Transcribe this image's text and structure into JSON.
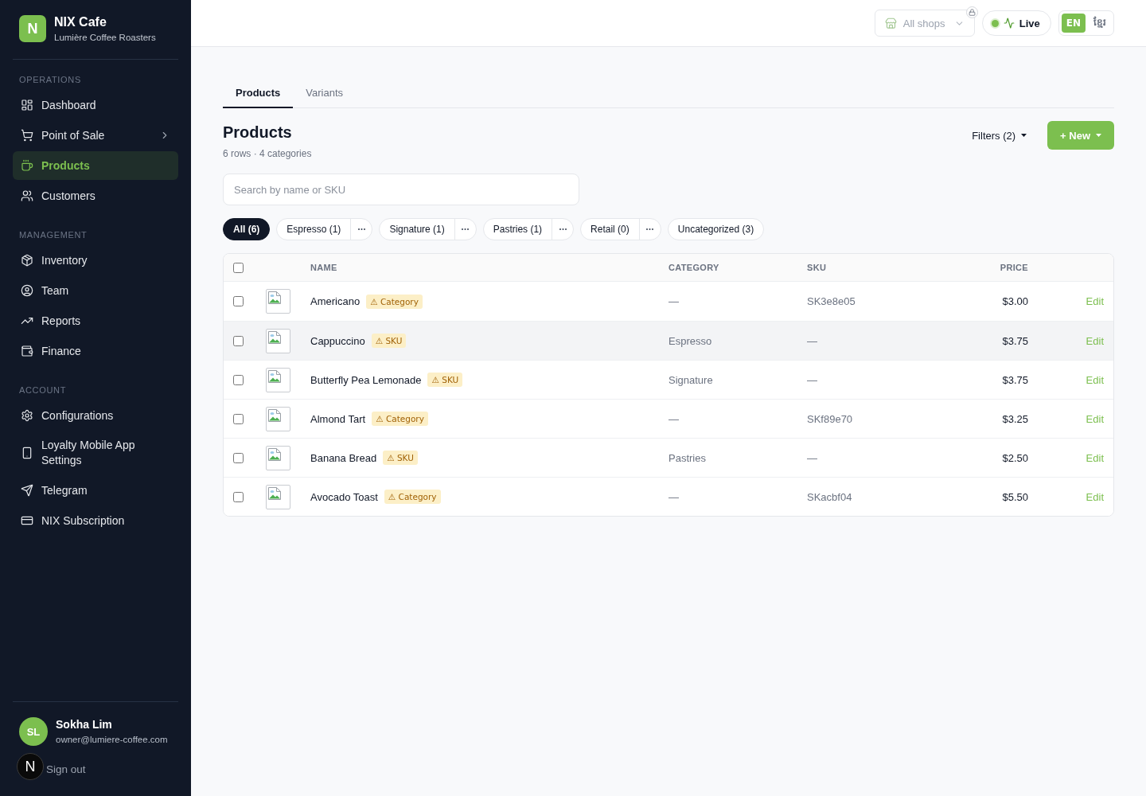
{
  "sidebar": {
    "brand": {
      "logo": "N",
      "name": "NIX Cafe",
      "subtitle": "Lumière Coffee Roasters"
    },
    "sections": [
      {
        "title": "OPERATIONS",
        "items": [
          {
            "label": "Dashboard",
            "selected": false,
            "has_submenu": false
          },
          {
            "label": "Point of Sale",
            "selected": false,
            "has_submenu": true
          },
          {
            "label": "Products",
            "selected": true,
            "has_submenu": false
          },
          {
            "label": "Customers",
            "selected": false,
            "has_submenu": false
          }
        ]
      },
      {
        "title": "MANAGEMENT",
        "items": [
          {
            "label": "Inventory",
            "selected": false,
            "has_submenu": false
          },
          {
            "label": "Team",
            "selected": false,
            "has_submenu": false
          },
          {
            "label": "Reports",
            "selected": false,
            "has_submenu": false
          },
          {
            "label": "Finance",
            "selected": false,
            "has_submenu": false
          }
        ]
      },
      {
        "title": "ACCOUNT",
        "items": [
          {
            "label": "Configurations",
            "selected": false,
            "has_submenu": false
          },
          {
            "label": "Loyalty Mobile App Settings",
            "selected": false,
            "has_submenu": false
          },
          {
            "label": "Telegram",
            "selected": false,
            "has_submenu": false
          },
          {
            "label": "NIX Subscription",
            "selected": false,
            "has_submenu": false
          }
        ]
      }
    ],
    "user": {
      "initials": "SL",
      "name": "Sokha Lim",
      "email": "owner@lumiere-coffee.com"
    },
    "sign_out": "Sign out"
  },
  "top_bar": {
    "shop_selector": {
      "label": "All shops",
      "locked": true
    },
    "live_status": {
      "label": "Live"
    },
    "languages": [
      {
        "label": "EN",
        "selected": true
      },
      {
        "label": "ខ្មែរ",
        "selected": false
      }
    ]
  },
  "tabs": [
    {
      "label": "Products",
      "selected": true
    },
    {
      "label": "Variants",
      "selected": false
    }
  ],
  "page_header": {
    "title": "Products",
    "subtitle": "6 rows · 4 categories",
    "filters_button": "Filters (2)",
    "new_button": "+ New"
  },
  "search": {
    "placeholder": "Search by name or SKU"
  },
  "category_chips": [
    {
      "label": "All (6)",
      "selected": true,
      "has_menu": false
    },
    {
      "label": "Espresso (1)",
      "selected": false,
      "has_menu": true
    },
    {
      "label": "Signature (1)",
      "selected": false,
      "has_menu": true
    },
    {
      "label": "Pastries (1)",
      "selected": false,
      "has_menu": true
    },
    {
      "label": "Retail (0)",
      "selected": false,
      "has_menu": true
    },
    {
      "label": "Uncategorized (3)",
      "selected": false,
      "has_menu": false
    }
  ],
  "table": {
    "all_checked": false,
    "columns": [
      "NAME",
      "CATEGORY",
      "SKU",
      "PRICE"
    ],
    "rows": [
      {
        "name": "Americano",
        "warning": "⚠ Category",
        "category": "—",
        "sku": "SK3e8e05",
        "price": "$3.00",
        "action": "Edit",
        "checked": false,
        "hovered": false
      },
      {
        "name": "Cappuccino",
        "warning": "⚠ SKU",
        "category": "Espresso",
        "sku": "—",
        "price": "$3.75",
        "action": "Edit",
        "checked": false,
        "hovered": true
      },
      {
        "name": "Butterfly Pea Lemonade",
        "warning": "⚠ SKU",
        "category": "Signature",
        "sku": "—",
        "price": "$3.75",
        "action": "Edit",
        "checked": false,
        "hovered": false
      },
      {
        "name": "Almond Tart",
        "warning": "⚠ Category",
        "category": "—",
        "sku": "SKf89e70",
        "price": "$3.25",
        "action": "Edit",
        "checked": false,
        "hovered": false
      },
      {
        "name": "Banana Bread",
        "warning": "⚠ SKU",
        "category": "Pastries",
        "sku": "—",
        "price": "$2.50",
        "action": "Edit",
        "checked": false,
        "hovered": false
      },
      {
        "name": "Avocado Toast",
        "warning": "⚠ Category",
        "category": "—",
        "sku": "SKacbf04",
        "price": "$5.50",
        "action": "Edit",
        "checked": false,
        "hovered": false
      }
    ]
  },
  "dev_indicator": {
    "label": "N"
  }
}
